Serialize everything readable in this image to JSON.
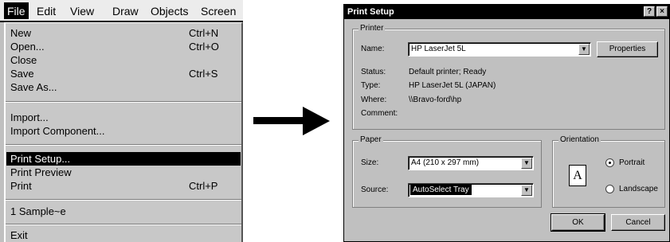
{
  "menubar": {
    "items": [
      "File",
      "Edit",
      "View",
      "Draw",
      "Objects",
      "Screen"
    ]
  },
  "file_menu": {
    "new": {
      "label": "New",
      "shortcut": "Ctrl+N"
    },
    "open": {
      "label": "Open...",
      "shortcut": "Ctrl+O"
    },
    "close": {
      "label": "Close"
    },
    "save": {
      "label": "Save",
      "shortcut": "Ctrl+S"
    },
    "save_as": {
      "label": "Save As..."
    },
    "import": {
      "label": "Import..."
    },
    "import_component": {
      "label": "Import Component..."
    },
    "print_setup": {
      "label": "Print Setup..."
    },
    "print_preview": {
      "label": "Print Preview"
    },
    "print": {
      "label": "Print",
      "shortcut": "Ctrl+P"
    },
    "recent": {
      "label": "1 Sample~e"
    },
    "exit": {
      "label": "Exit"
    }
  },
  "arrow": {
    "icon": "right-arrow-icon",
    "color": "#000000"
  },
  "dialog": {
    "title": "Print Setup",
    "help_button": "?",
    "close_button": "×",
    "printer": {
      "legend": "Printer",
      "name_label": "Name:",
      "name_value": "HP LaserJet 5L",
      "properties_button": "Properties",
      "status_label": "Status:",
      "status_value": "Default printer; Ready",
      "type_label": "Type:",
      "type_value": "HP LaserJet 5L (JAPAN)",
      "where_label": "Where:",
      "where_value": "\\\\Bravo-ford\\hp",
      "comment_label": "Comment:",
      "comment_value": ""
    },
    "paper": {
      "legend": "Paper",
      "size_label": "Size:",
      "size_value": "A4 (210 x 297 mm)",
      "source_label": "Source:",
      "source_value": "AutoSelect Tray"
    },
    "orientation": {
      "legend": "Orientation",
      "icon_letter": "A",
      "portrait_label": "Portrait",
      "landscape_label": "Landscape",
      "selected": "Portrait"
    },
    "ok_button": "OK",
    "cancel_button": "Cancel"
  }
}
